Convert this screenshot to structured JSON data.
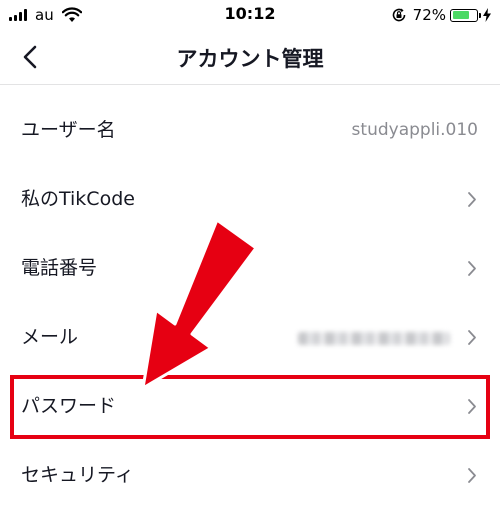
{
  "status": {
    "carrier": "au",
    "time": "10:12",
    "battery_percent": "72%",
    "battery_level": 0.72
  },
  "nav": {
    "title": "アカウント管理"
  },
  "rows": [
    {
      "label": "ユーザー名",
      "value": "studyappli.010"
    },
    {
      "label": "私のTikCode"
    },
    {
      "label": "電話番号"
    },
    {
      "label": "メール"
    },
    {
      "label": "パスワード"
    },
    {
      "label": "セキュリティ"
    }
  ],
  "colors": {
    "accent_red": "#e60012",
    "battery_green": "#4cd964",
    "text_primary": "#161823",
    "text_secondary": "#8a8b91"
  },
  "icons": [
    "signal-icon",
    "wifi-icon",
    "rotation-lock-icon",
    "battery-icon",
    "charging-bolt-icon",
    "back-chevron-icon",
    "chevron-right-icon",
    "red-arrow-annotation"
  ]
}
